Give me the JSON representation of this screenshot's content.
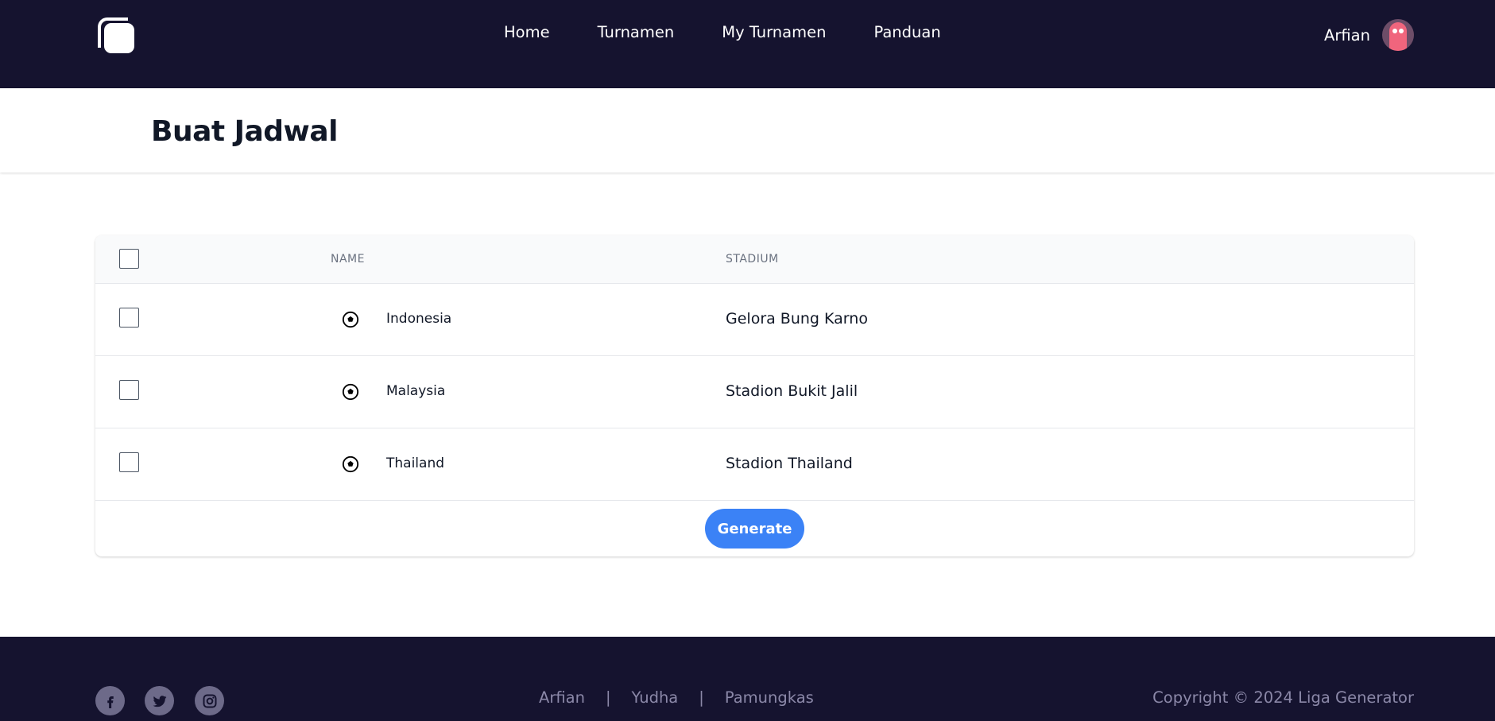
{
  "nav": {
    "links": [
      "Home",
      "Turnamen",
      "My Turnamen",
      "Panduan"
    ],
    "user_name": "Arfian"
  },
  "header": {
    "title": "Buat Jadwal"
  },
  "table": {
    "columns": [
      "NAME",
      "STADIUM"
    ],
    "rows": [
      {
        "name": "Indonesia",
        "stadium": "Gelora Bung Karno"
      },
      {
        "name": "Malaysia",
        "stadium": "Stadion Bukit Jalil"
      },
      {
        "name": "Thailand",
        "stadium": "Stadion Thailand"
      }
    ],
    "generate_label": "Generate"
  },
  "footer": {
    "social_icons": [
      "facebook-icon",
      "twitter-icon",
      "instagram-icon"
    ],
    "links": [
      "Arfian",
      "Yudha",
      "Pamungkas"
    ],
    "separator": "|",
    "copyright": "Copyright © 2024 Liga Generator"
  },
  "colors": {
    "navbar_bg": "#15132f",
    "accent": "#3b82f6"
  }
}
